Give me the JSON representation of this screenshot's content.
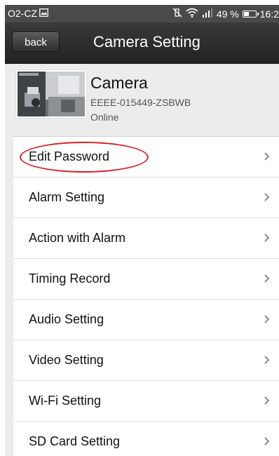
{
  "status_bar": {
    "carrier": "O2-CZ",
    "battery_percent": "49 %",
    "time": "16:2",
    "battery_level": 0.49
  },
  "header": {
    "back_label": "back",
    "title": "Camera Setting"
  },
  "camera": {
    "name": "Camera",
    "id": "EEEE-015449-ZSBWB",
    "status": "Online"
  },
  "menu": {
    "items": [
      {
        "label": "Edit Password",
        "highlighted": true
      },
      {
        "label": "Alarm Setting"
      },
      {
        "label": "Action with Alarm"
      },
      {
        "label": "Timing Record"
      },
      {
        "label": "Audio Setting"
      },
      {
        "label": "Video Setting"
      },
      {
        "label": "Wi-Fi Setting"
      },
      {
        "label": "SD Card Setting"
      }
    ]
  },
  "colors": {
    "status_bar_bg": "#4a4a4a",
    "title_bar_bg": "#2c2c2c",
    "page_bg": "#ececec",
    "highlight_oval": "#d4242a",
    "chevron": "#8a8a8a"
  }
}
